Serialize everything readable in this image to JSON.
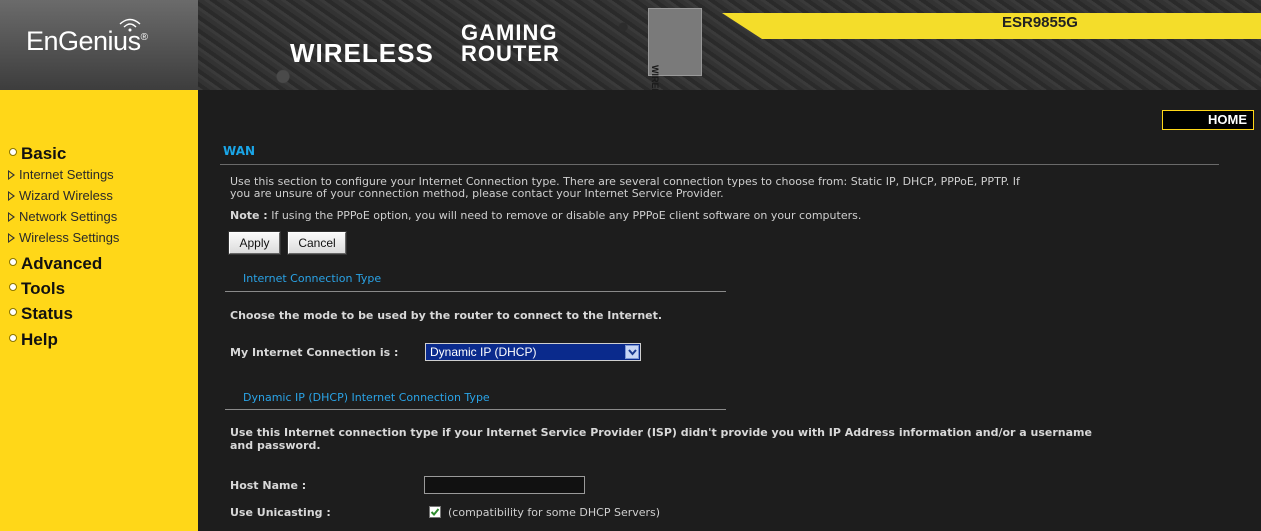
{
  "header": {
    "logo": "EnGenius",
    "logo_mark": "®",
    "banner_wireless": "WIRELESS",
    "banner_gaming": "GAMING",
    "banner_router": "ROUTER",
    "banner_vertical": "WIRELESS ROUTER",
    "model": "ESR9855G",
    "accent_color": "#ffd718"
  },
  "sidebar": {
    "sections": [
      {
        "label": "Basic",
        "items": [
          "Internet Settings",
          "Wizard Wireless",
          "Network Settings",
          "Wireless Settings"
        ]
      },
      {
        "label": "Advanced"
      },
      {
        "label": "Tools"
      },
      {
        "label": "Status"
      },
      {
        "label": "Help"
      }
    ]
  },
  "main": {
    "home_button": "HOME",
    "title": "WAN",
    "intro_line1": "Use this section to configure your Internet Connection type. There are several connection types to choose from: Static IP, DHCP, PPPoE, PPTP. If",
    "intro_line2": "you are unsure of your connection method, please contact your Internet Service Provider.",
    "note_label": "Note :",
    "note_text": "If using the PPPoE option, you will need to remove or disable any PPPoE client software on your computers.",
    "apply_button": "Apply",
    "cancel_button": "Cancel",
    "section1_title": "Internet Connection Type",
    "section1_desc": "Choose the mode to be used by the router to connect to the Internet.",
    "connection_label": "My Internet Connection is :",
    "connection_value": "Dynamic IP (DHCP)",
    "section2_title": "Dynamic IP (DHCP) Internet Connection Type",
    "section2_desc_line1": "Use this Internet connection type if your Internet Service Provider (ISP) didn't provide you with IP Address information and/or a username",
    "section2_desc_line2": "and password.",
    "host_name_label": "Host Name :",
    "host_name_value": "",
    "unicasting_label": "Use Unicasting :",
    "unicasting_checked": true,
    "unicasting_hint": "(compatibility for some DHCP Servers)"
  }
}
